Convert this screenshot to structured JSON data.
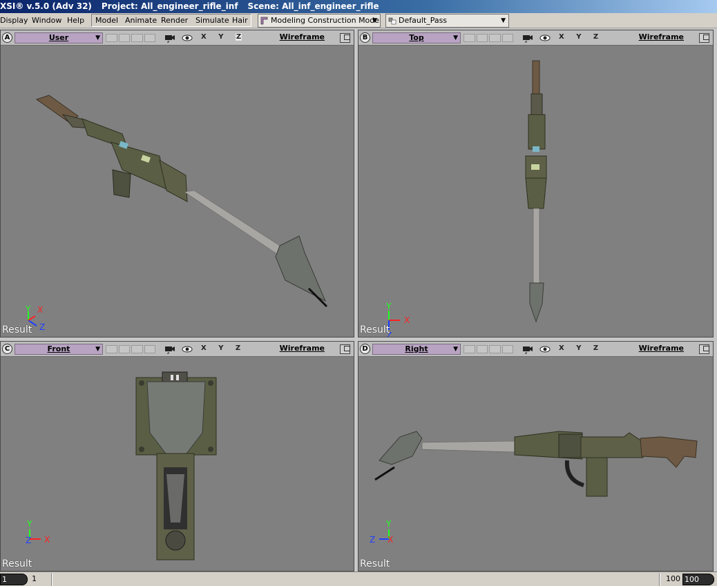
{
  "titlebar": {
    "app": "XSI® v.5.0 (Adv 32)",
    "project": "Project: All_engineer_rifle_inf",
    "scene": "Scene: All_inf_engineer_rifle"
  },
  "menu": {
    "items_left": [
      "Display",
      "Window",
      "Help"
    ],
    "items_right": [
      "Model",
      "Animate",
      "Render",
      "Simulate",
      "Hair"
    ],
    "mode_combo": "Modeling Construction Mode",
    "pass_combo": "Default_Pass"
  },
  "viewports": [
    {
      "letter": "A",
      "camera": "User",
      "mode": "Wireframe",
      "axes": "X Y Z",
      "result": "Result",
      "view_colors": {
        "shaft": "#a8a6a2"
      }
    },
    {
      "letter": "B",
      "camera": "Top",
      "mode": "Wireframe",
      "axes": "X Y Z",
      "result": "Result"
    },
    {
      "letter": "C",
      "camera": "Front",
      "mode": "Wireframe",
      "axes": "X Y Z",
      "result": "Result"
    },
    {
      "letter": "D",
      "camera": "Right",
      "mode": "Wireframe",
      "axes": "X Y Z",
      "result": "Result"
    }
  ],
  "axis_labels": {
    "x": "X",
    "y": "Y",
    "z": "Z"
  },
  "statusbar": {
    "frame_start": "1",
    "frame_current": "1",
    "frame_end_label": "100",
    "frame_end": "100"
  },
  "colors": {
    "viewport_bg": "#808080",
    "camera_chip": "#b8a4c2",
    "axis_x": "#ff2020",
    "axis_y": "#20ff20",
    "axis_z": "#2040ff",
    "model_body": "#5a5e44",
    "model_stock": "#6e5a44",
    "model_barrel": "#b0aeaa"
  }
}
